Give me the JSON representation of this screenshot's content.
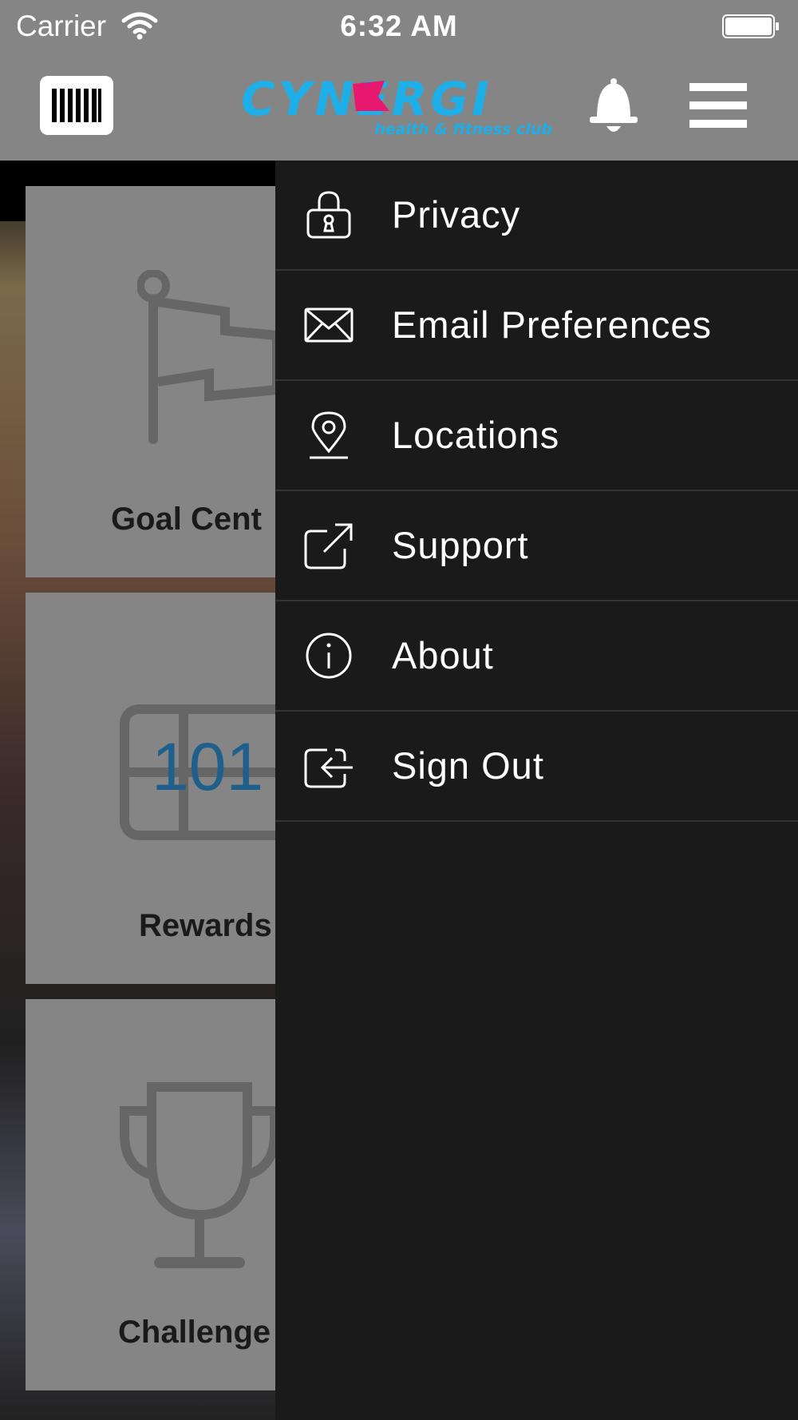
{
  "status_bar": {
    "carrier": "Carrier",
    "time": "6:32 AM"
  },
  "header": {
    "logo_text": "CYNERGI",
    "logo_subtitle": "health & fitness club",
    "barcode_icon": "barcode-icon",
    "bell_icon": "bell-icon",
    "menu_icon": "hamburger-menu-icon"
  },
  "tiles": [
    {
      "label": "Goal Cent",
      "icon": "flag-icon"
    },
    {
      "label": "Rewards",
      "icon": "ticket-icon",
      "badge": "101"
    },
    {
      "label": "Challenge",
      "icon": "trophy-icon"
    }
  ],
  "drawer": {
    "items": [
      {
        "label": "Privacy",
        "icon": "lock-icon"
      },
      {
        "label": "Email Preferences",
        "icon": "envelope-icon"
      },
      {
        "label": "Locations",
        "icon": "location-pin-icon"
      },
      {
        "label": "Support",
        "icon": "external-link-icon"
      },
      {
        "label": "About",
        "icon": "info-icon"
      },
      {
        "label": "Sign Out",
        "icon": "sign-out-icon"
      }
    ]
  },
  "colors": {
    "header_bg": "#858585",
    "drawer_bg": "#1a1a1a",
    "brand_blue": "#1eaee8",
    "brand_pink": "#e8176f",
    "reward_blue": "#1e5f8c"
  }
}
